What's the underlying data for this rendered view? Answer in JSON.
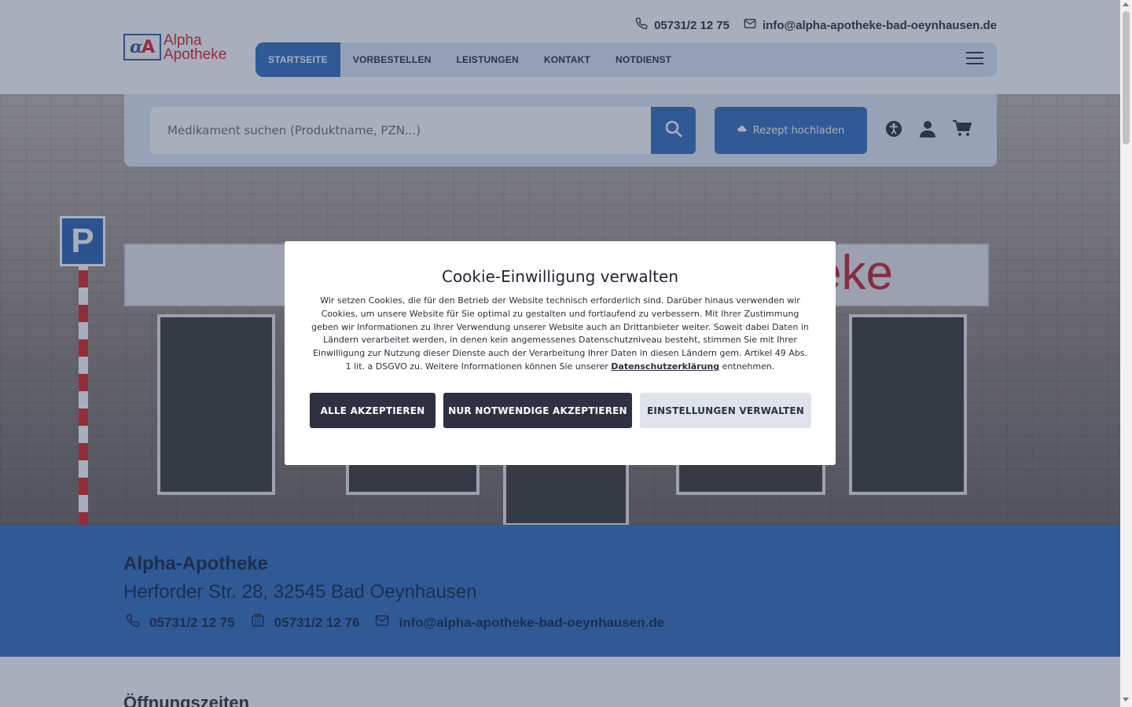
{
  "header": {
    "phone": "05731/2 12 75",
    "email": "info@alpha-apotheke-bad-oeynhausen.de",
    "logo": {
      "line1": "Alpha",
      "line2": "Apotheke"
    }
  },
  "nav": {
    "items": [
      {
        "label": "STARTSEITE",
        "active": true
      },
      {
        "label": "VORBESTELLEN"
      },
      {
        "label": "LEISTUNGEN"
      },
      {
        "label": "KONTAKT"
      },
      {
        "label": "NOTDIENST"
      }
    ]
  },
  "search": {
    "placeholder": "Medikament suchen (Produktname, PZN...)",
    "rezept_label": "Rezept hochladen"
  },
  "hero": {
    "sign_text": "Apotheke",
    "parking_letter": "P"
  },
  "info": {
    "name": "Alpha-Apotheke",
    "address": "Herforder Str. 28, 32545 Bad Oeynhausen",
    "phone": "05731/2 12 75",
    "fax": "05731/2 12 76",
    "email": "info@alpha-apotheke-bad-oeynhausen.de"
  },
  "hours": {
    "title": "Öffnungszeiten"
  },
  "cookie": {
    "title": "Cookie-Einwilligung verwalten",
    "text": "Wir setzen Cookies, die für den Betrieb der Website technisch erforderlich sind. Darüber hinaus verwenden wir Cookies, um unsere Website für Sie optimal zu gestalten und fortlaufend zu verbessern. Mit Ihrer Zustimmung geben wir Informationen zu Ihrer Verwendung unserer Website auch an Drittanbieter weiter. Soweit dabei Daten in Ländern verarbeitet werden, in denen kein angemessenes Datenschutzniveau besteht, stimmen Sie mit Ihrer Einwilligung zur Nutzung dieser Dienste auch der Verarbeitung Ihrer Daten in diesen Ländern gem. Artikel 49 Abs. 1 lit. a DSGVO zu. Weitere Informationen können Sie unserer",
    "link": "Datenschutzerklärung",
    "text_end": "entnehmen.",
    "accept_all": "ALLE AKZEPTIEREN",
    "accept_necessary": "NUR NOTWENDIGE AKZEPTIEREN",
    "settings": "EINSTELLUNGEN VERWALTEN"
  },
  "colors": {
    "primary": "#2f6fc0",
    "dark_button": "#2d3142",
    "brand_red": "#d8232a"
  },
  "icons": [
    "phone-icon",
    "mail-icon",
    "menu-icon",
    "search-icon",
    "upload-icon",
    "accessibility-icon",
    "user-icon",
    "cart-icon",
    "fax-icon"
  ]
}
